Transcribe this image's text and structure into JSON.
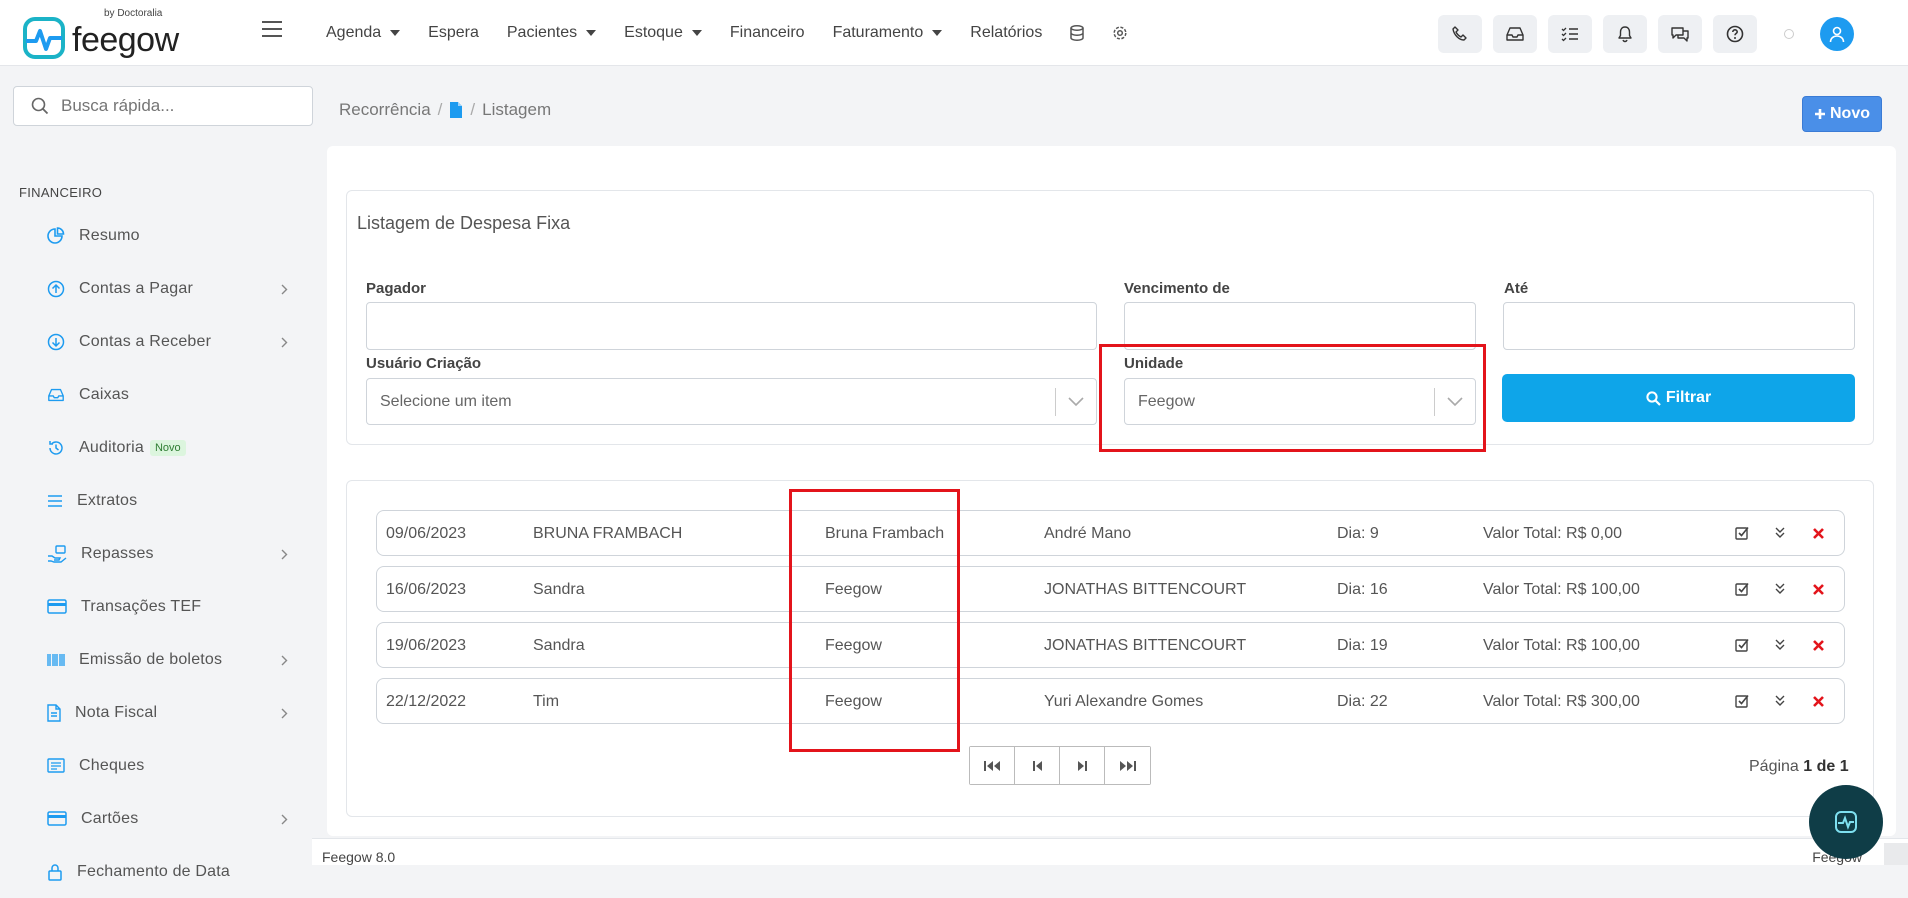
{
  "app": {
    "brand": "feegow",
    "brand_by": "by Doctoralia"
  },
  "nav": {
    "items": [
      {
        "label": "Agenda",
        "dropdown": true
      },
      {
        "label": "Espera",
        "dropdown": false
      },
      {
        "label": "Pacientes",
        "dropdown": true
      },
      {
        "label": "Estoque",
        "dropdown": true
      },
      {
        "label": "Financeiro",
        "dropdown": false
      },
      {
        "label": "Faturamento",
        "dropdown": true
      },
      {
        "label": "Relatórios",
        "dropdown": false
      }
    ],
    "icons": [
      "database-icon",
      "gear-icon"
    ]
  },
  "top_actions": [
    "phone-icon",
    "inbox-icon",
    "tasks-icon",
    "bell-icon",
    "chat-icon",
    "help-icon"
  ],
  "search": {
    "placeholder": "Busca rápida..."
  },
  "sidebar": {
    "section_title": "FINANCEIRO",
    "items": [
      {
        "label": "Resumo",
        "icon": "pie-chart-icon",
        "chevron": false
      },
      {
        "label": "Contas a Pagar",
        "icon": "arrow-up-circle-icon",
        "chevron": true
      },
      {
        "label": "Contas a Receber",
        "icon": "arrow-down-circle-icon",
        "chevron": true
      },
      {
        "label": "Caixas",
        "icon": "inbox-icon",
        "chevron": false
      },
      {
        "label": "Auditoria",
        "icon": "history-icon",
        "chevron": false,
        "badge": "Novo"
      },
      {
        "label": "Extratos",
        "icon": "list-icon",
        "chevron": false
      },
      {
        "label": "Repasses",
        "icon": "hand-money-icon",
        "chevron": true
      },
      {
        "label": "Transações TEF",
        "icon": "credit-card-icon",
        "chevron": false
      },
      {
        "label": "Emissão de boletos",
        "icon": "barcode-icon",
        "chevron": true
      },
      {
        "label": "Nota Fiscal",
        "icon": "document-icon",
        "chevron": true
      },
      {
        "label": "Cheques",
        "icon": "cheque-icon",
        "chevron": false
      },
      {
        "label": "Cartões",
        "icon": "credit-card-icon",
        "chevron": true
      },
      {
        "label": "Fechamento de Data",
        "icon": "lock-icon",
        "chevron": false
      }
    ]
  },
  "breadcrumb": {
    "root": "Recorrência",
    "current": "Listagem"
  },
  "novo_button": "Novo",
  "filters": {
    "title": "Listagem de Despesa Fixa",
    "pagador_label": "Pagador",
    "vencimento_label": "Vencimento de",
    "ate_label": "Até",
    "usuario_label": "Usuário Criação",
    "usuario_placeholder": "Selecione um item",
    "unidade_label": "Unidade",
    "unidade_value": "Feegow",
    "filtrar_label": "Filtrar"
  },
  "rows": [
    {
      "date": "09/06/2023",
      "name": "BRUNA FRAMBACH",
      "unit": "Bruna Frambach",
      "user": "André Mano",
      "day": "Dia: 9",
      "total": "Valor Total: R$ 0,00"
    },
    {
      "date": "16/06/2023",
      "name": "Sandra",
      "unit": "Feegow",
      "user": "JONATHAS BITTENCOURT",
      "day": "Dia: 16",
      "total": "Valor Total: R$ 100,00"
    },
    {
      "date": "19/06/2023",
      "name": "Sandra",
      "unit": "Feegow",
      "user": "JONATHAS BITTENCOURT",
      "day": "Dia: 19",
      "total": "Valor Total: R$ 100,00"
    },
    {
      "date": "22/12/2022",
      "name": "Tim",
      "unit": "Feegow",
      "user": "Yuri Alexandre Gomes",
      "day": "Dia: 22",
      "total": "Valor Total: R$ 300,00"
    }
  ],
  "pagination": {
    "prefix": "Página",
    "current": "1 de 1"
  },
  "footer": {
    "left": "Feegow 8.0",
    "right": "Feegow"
  },
  "colors": {
    "primary": "#0ea5e9",
    "novo": "#4a8fe8",
    "highlight": "#e3141b",
    "delete": "#e3141b",
    "icon": "#1d9bf0"
  }
}
